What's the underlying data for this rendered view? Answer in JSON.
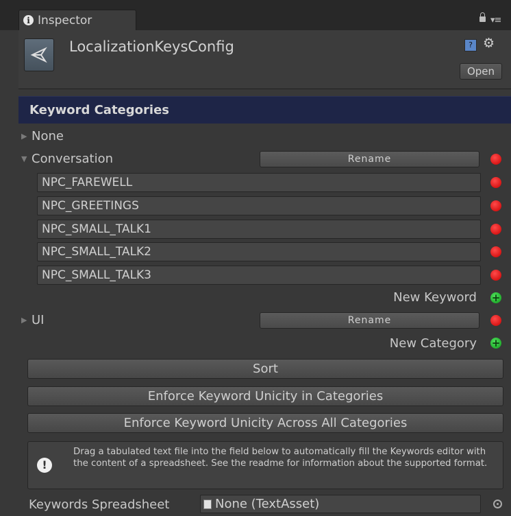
{
  "window": {
    "tab_title": "Inspector"
  },
  "header": {
    "asset_name": "LocalizationKeysConfig",
    "open_button": "Open"
  },
  "section": {
    "title": "Keyword Categories"
  },
  "categories": [
    {
      "label": "None",
      "expanded": false
    },
    {
      "label": "Conversation",
      "expanded": true,
      "rename_label": "Rename",
      "keywords": [
        "NPC_FAREWELL",
        "NPC_GREETINGS",
        "NPC_SMALL_TALK1",
        "NPC_SMALL_TALK2",
        "NPC_SMALL_TALK3"
      ],
      "new_keyword_label": "New Keyword"
    },
    {
      "label": "UI",
      "expanded": false,
      "rename_label": "Rename"
    }
  ],
  "new_category_label": "New Category",
  "buttons": {
    "sort": "Sort",
    "enforce_categories": "Enforce Keyword Unicity in Categories",
    "enforce_across": "Enforce Keyword Unicity Across All Categories"
  },
  "help": {
    "text": "Drag a tabulated text file into the field below to automatically fill the Keywords editor with the content of a spreadsheet. See the readme for information about the supported format."
  },
  "spreadsheet": {
    "label": "Keywords Spreadsheet",
    "value": "None (TextAsset)"
  },
  "icons": {
    "info": "i",
    "book": "?",
    "gear": "⚙",
    "menu": "▾≡",
    "warning": "!",
    "add": "+"
  }
}
